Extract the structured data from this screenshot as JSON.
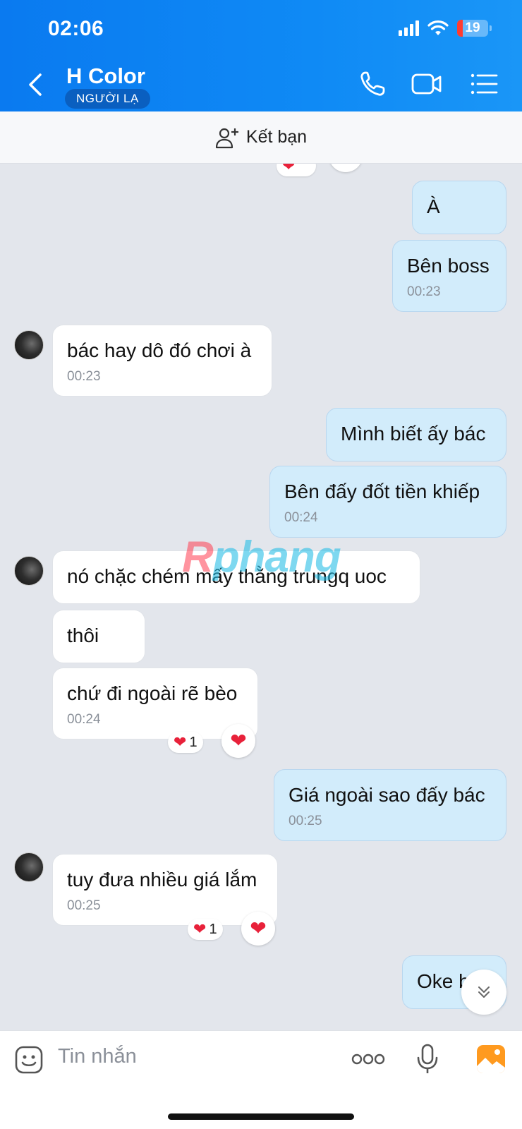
{
  "status": {
    "time": "02:06",
    "battery": "19"
  },
  "header": {
    "title": "H Color",
    "badge": "NGƯỜI LẠ"
  },
  "friend_bar": {
    "label": "Kết bạn"
  },
  "messages": [
    {
      "dir": "out",
      "text": "À",
      "time": ""
    },
    {
      "dir": "out",
      "text": "Bên boss",
      "time": "00:23"
    },
    {
      "dir": "in",
      "text": "bác hay dô đó chơi à",
      "time": "00:23"
    },
    {
      "dir": "out",
      "text": "Mình biết ấy bác",
      "time": ""
    },
    {
      "dir": "out",
      "text": "Bên đấy đốt tiền khiếp",
      "time": "00:24"
    },
    {
      "dir": "in",
      "text": "nó chặc chém mấy thằng trungq uoc",
      "time": ""
    },
    {
      "dir": "in",
      "text": "thôi",
      "time": ""
    },
    {
      "dir": "in",
      "text": "chứ đi ngoài rẽ bèo",
      "time": "00:24",
      "reaction_count": "1"
    },
    {
      "dir": "out",
      "text": "Giá ngoài sao đấy bác",
      "time": "00:25"
    },
    {
      "dir": "in",
      "text": "tuy đưa nhiều giá lắm",
      "time": "00:25",
      "reaction_count": "1"
    },
    {
      "dir": "out",
      "text": "Oke b",
      "time": ""
    }
  ],
  "watermark": {
    "part1": "R",
    "part2": "phang"
  },
  "input": {
    "placeholder": "Tin nhắn"
  },
  "colors": {
    "header": "#0a7af0",
    "out_bubble": "#d2ecfb",
    "in_bubble": "#ffffff",
    "heart": "#e8213a"
  },
  "icons": [
    "back-icon",
    "phone-icon",
    "video-call-icon",
    "menu-icon",
    "add-friend-icon",
    "sticker-icon",
    "more-icon",
    "microphone-icon",
    "image-icon",
    "chevron-down-icon",
    "heart-icon"
  ]
}
